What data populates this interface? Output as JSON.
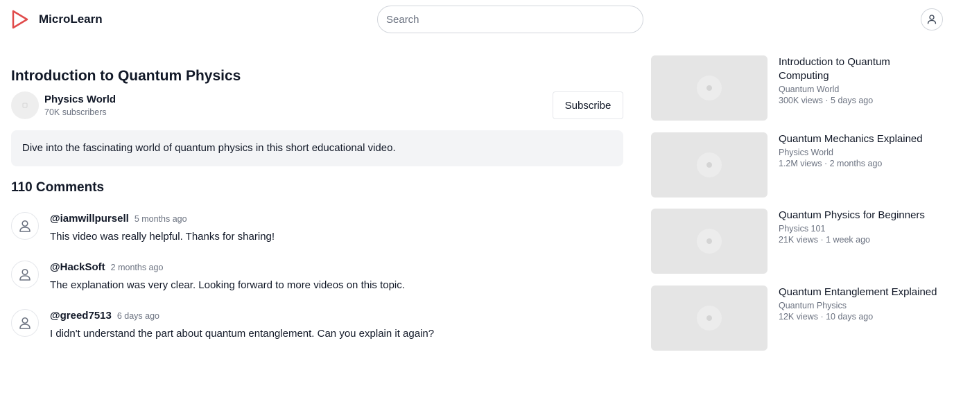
{
  "header": {
    "app_name": "MicroLearn",
    "logo_icon": "play-triangle-icon",
    "logo_color": "#e04b4b",
    "search_placeholder": "Search",
    "user_icon": "user-icon"
  },
  "video": {
    "title": "Introduction to Quantum Physics",
    "channel": {
      "name": "Physics World",
      "subscribers": "70K subscribers"
    },
    "subscribe_label": "Subscribe",
    "description": "Dive into the fascinating world of quantum physics in this short educational video."
  },
  "comments": {
    "heading": "110 Comments",
    "items": [
      {
        "author": "@iamwillpursell",
        "time": "5 months ago",
        "text": "This video was really helpful. Thanks for sharing!"
      },
      {
        "author": "@HackSoft",
        "time": "2 months ago",
        "text": "The explanation was very clear. Looking forward to more videos on this topic."
      },
      {
        "author": "@greed7513",
        "time": "6 days ago",
        "text": "I didn't understand the part about quantum entanglement. Can you explain it again?"
      }
    ]
  },
  "recommended": [
    {
      "title": "Introduction to Quantum Computing",
      "channel": "Quantum World",
      "meta": "300K views · 5 days ago"
    },
    {
      "title": "Quantum Mechanics Explained",
      "channel": "Physics World",
      "meta": "1.2M views · 2 months ago"
    },
    {
      "title": "Quantum Physics for Beginners",
      "channel": "Physics 101",
      "meta": "21K views · 1 week ago"
    },
    {
      "title": "Quantum Entanglement Explained",
      "channel": "Quantum Physics",
      "meta": "12K views · 10 days ago"
    }
  ]
}
